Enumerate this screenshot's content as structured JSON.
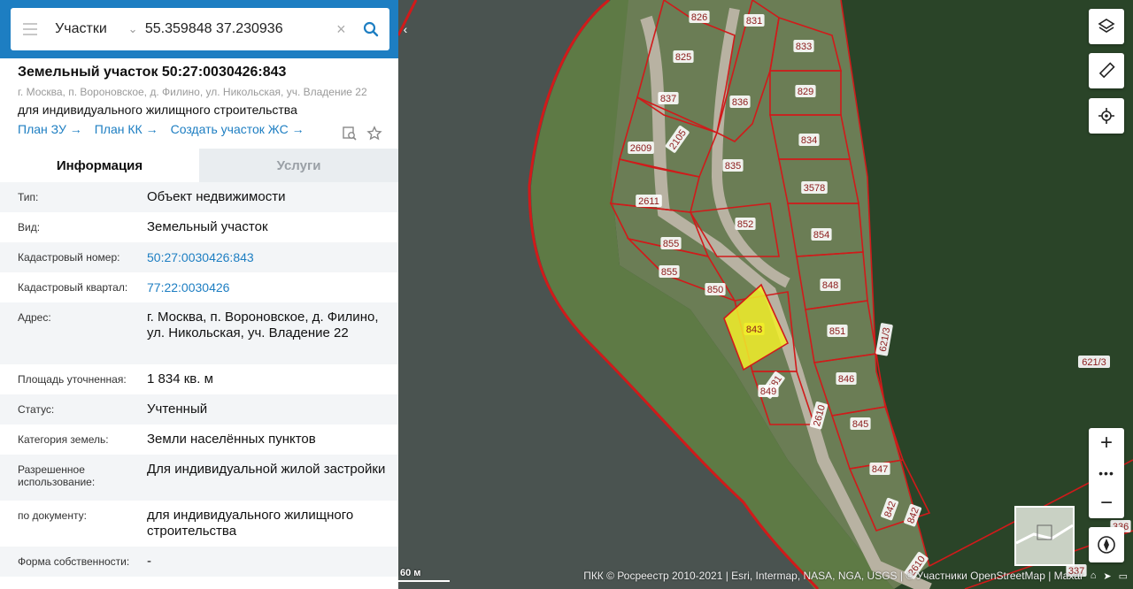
{
  "search": {
    "category": "Участки",
    "query": "55.359848 37.230936"
  },
  "parcel": {
    "title": "Земельный участок 50:27:0030426:843",
    "address_short": "г. Москва, п. Вороновское, д. Филино, ул. Никольская, уч. Владение 22",
    "purpose": "для индивидуального жилищного строительства",
    "links": [
      "План ЗУ →",
      "План КК →",
      "Создать участок ЖС →"
    ]
  },
  "tabs": [
    "Информация",
    "Услуги"
  ],
  "info_rows": [
    {
      "key": "Тип:",
      "value": "Объект недвижимости"
    },
    {
      "key": "Вид:",
      "value": "Земельный участок"
    },
    {
      "key": "Кадастровый номер:",
      "value": "50:27:0030426:843"
    },
    {
      "key": "Кадастровый квартал:",
      "value": "77:22:0030426"
    },
    {
      "key": "Адрес:",
      "value": "г. Москва, п. Вороновское, д. Филино, ул. Никольская, уч. Владение 22"
    },
    {
      "key": "Площадь уточненная:",
      "value": "1 834 кв. м"
    },
    {
      "key": "Статус:",
      "value": "Учтенный"
    },
    {
      "key": "Категория земель:",
      "value": "Земли населённых пунктов"
    },
    {
      "key": "Разрешенное использование:",
      "value": "Для индивидуальной жилой застройки"
    },
    {
      "key": "по документу:",
      "value": "для индивидуального жилищного строительства"
    },
    {
      "key": "Форма собственности:",
      "value": "-"
    }
  ],
  "map": {
    "plot_labels": [
      "826",
      "831",
      "833",
      "825",
      "836",
      "829",
      "837",
      "2105",
      "834",
      "2609",
      "835",
      "3578",
      "2611",
      "852",
      "854",
      "855",
      "855",
      "850",
      "848",
      "843",
      "851",
      "621/3",
      "2581",
      "849",
      "846",
      "2610",
      "845",
      "847",
      "842",
      "842",
      "2610",
      "621/3",
      "336",
      "337"
    ],
    "selected_plot": "843",
    "scale_label": "60 м",
    "attribution": "ПКК © Росреестр 2010-2021 | Esri, Intermap, NASA, NGA, USGS | © Участники OpenStreetMap | Maxar",
    "colors": {
      "boundary": "#d11a1a",
      "selected_fill": "#f2ee2a",
      "water": "#49534f",
      "forest": "#2e4a2c",
      "field": "#6f8a52"
    }
  }
}
